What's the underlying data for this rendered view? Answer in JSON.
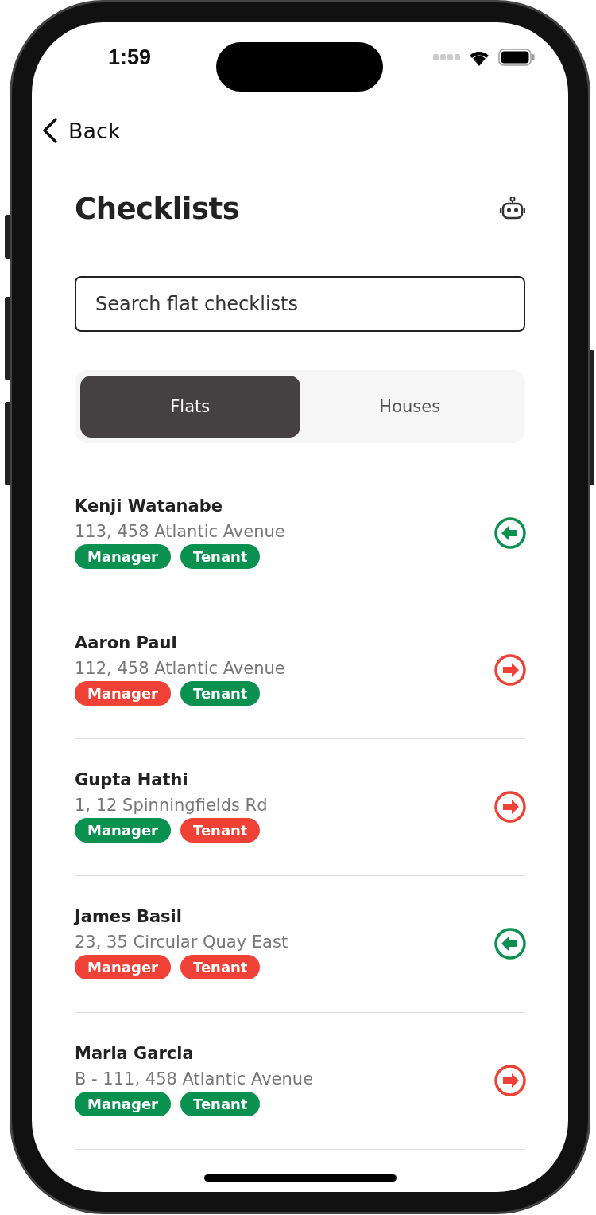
{
  "status_bar": {
    "time": "1:59"
  },
  "nav": {
    "back": "Back"
  },
  "header": {
    "title": "Checklists"
  },
  "search": {
    "placeholder": "Search flat checklists"
  },
  "tabs": [
    {
      "label": "Flats",
      "selected": true
    },
    {
      "label": "Houses",
      "selected": false
    }
  ],
  "rows": [
    {
      "name": "Kenji Watanabe",
      "address": "113, 458 Atlantic Avenue",
      "tags": [
        {
          "label": "Manager",
          "color": "#0a9150"
        },
        {
          "label": "Tenant",
          "color": "#0a9150"
        }
      ],
      "arrow": {
        "kind": "left",
        "color": "#0a9150"
      }
    },
    {
      "name": "Aaron Paul",
      "address": "112, 458 Atlantic Avenue",
      "tags": [
        {
          "label": "Manager",
          "color": "#ef4136"
        },
        {
          "label": "Tenant",
          "color": "#0a9150"
        }
      ],
      "arrow": {
        "kind": "right",
        "color": "#ef4136"
      }
    },
    {
      "name": "Gupta Hathi",
      "address": "1, 12 Spinningfields Rd",
      "tags": [
        {
          "label": "Manager",
          "color": "#0a9150"
        },
        {
          "label": "Tenant",
          "color": "#ef4136"
        }
      ],
      "arrow": {
        "kind": "right",
        "color": "#ef4136"
      }
    },
    {
      "name": "James Basil",
      "address": "23, 35 Circular Quay East",
      "tags": [
        {
          "label": "Manager",
          "color": "#ef4136"
        },
        {
          "label": "Tenant",
          "color": "#ef4136"
        }
      ],
      "arrow": {
        "kind": "left",
        "color": "#0a9150"
      }
    },
    {
      "name": "Maria Garcia",
      "address": "B - 111, 458 Atlantic Avenue",
      "tags": [
        {
          "label": "Manager",
          "color": "#0a9150"
        },
        {
          "label": "Tenant",
          "color": "#0a9150"
        }
      ],
      "arrow": {
        "kind": "right",
        "color": "#ef4136"
      }
    }
  ]
}
